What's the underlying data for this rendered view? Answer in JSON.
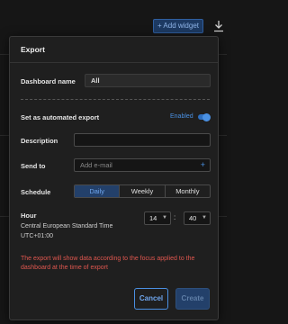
{
  "background": {
    "add_widget_label": "+ Add widget"
  },
  "modal": {
    "title": "Export",
    "dashboard_name_label": "Dashboard name",
    "dashboard_name_value": "All",
    "automated_export_label": "Set as automated export",
    "automated_enabled_label": "Enabled",
    "description_label": "Description",
    "description_value": "",
    "send_to_label": "Send to",
    "send_to_placeholder": "Add e-mail",
    "schedule_label": "Schedule",
    "schedule_options": [
      "Daily",
      "Weekly",
      "Monthly"
    ],
    "schedule_selected": "Daily",
    "hour_label": "Hour",
    "timezone_name": "Central European Standard Time",
    "timezone_offset": "UTC+01:00",
    "hour_value": "14",
    "minute_value": "40",
    "note": "The export will show data according to the focus applied to the dashboard at the time of export",
    "cancel_label": "Cancel",
    "create_label": "Create"
  },
  "colors": {
    "accent": "#4a90e2",
    "warning": "#e0574f",
    "background": "#1f1f1f"
  }
}
